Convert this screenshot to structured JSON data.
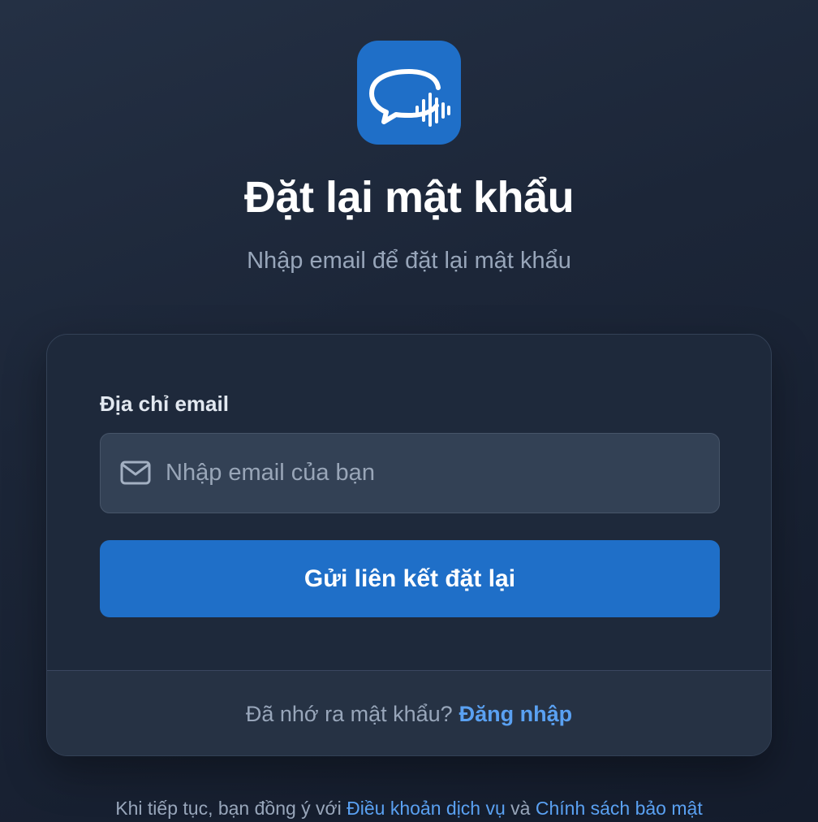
{
  "app": {
    "logo_icon": "chat-bubble-soundwave-icon",
    "accent_color": "#1f6fc8",
    "link_color": "#5aa1f2"
  },
  "header": {
    "title": "Đặt lại mật khẩu",
    "subtitle": "Nhập email để đặt lại mật khẩu"
  },
  "form": {
    "email_label": "Địa chỉ email",
    "email_icon": "mail-icon",
    "email_placeholder": "Nhập email của bạn",
    "email_value": "",
    "submit_label": "Gửi liên kết đặt lại"
  },
  "footer": {
    "remember_text": "Đã nhớ ra mật khẩu?",
    "login_link": "Đăng nhập"
  },
  "legal": {
    "prefix": "Khi tiếp tục, bạn đồng ý với",
    "terms_link": "Điều khoản dịch vụ",
    "conjunction": "và",
    "privacy_link": "Chính sách bảo mật"
  }
}
